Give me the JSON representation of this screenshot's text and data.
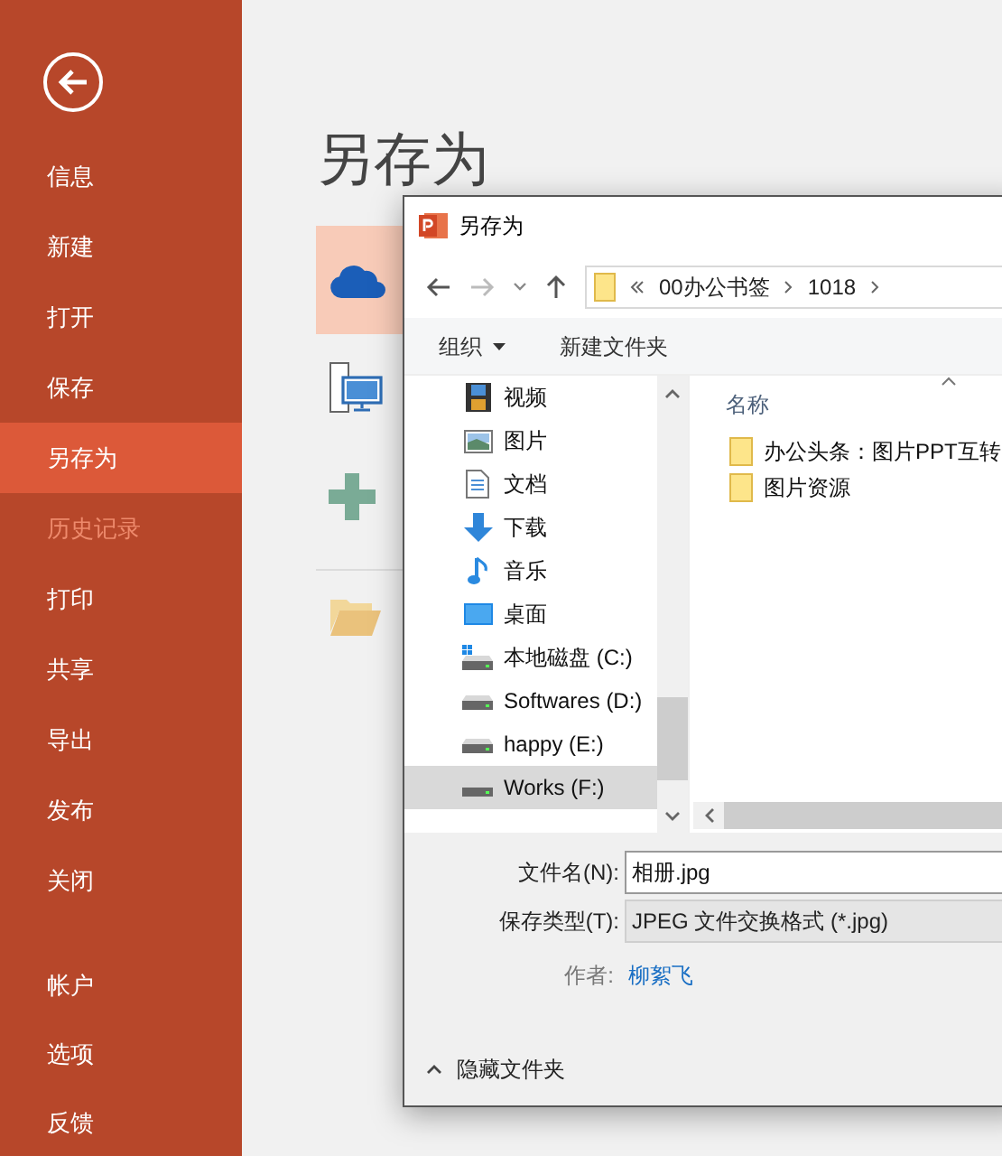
{
  "sidebar": {
    "items": [
      {
        "label": "信息",
        "selected": false,
        "disabled": false
      },
      {
        "label": "新建",
        "selected": false,
        "disabled": false
      },
      {
        "label": "打开",
        "selected": false,
        "disabled": false
      },
      {
        "label": "保存",
        "selected": false,
        "disabled": false
      },
      {
        "label": "另存为",
        "selected": true,
        "disabled": false
      },
      {
        "label": "历史记录",
        "selected": false,
        "disabled": true
      },
      {
        "label": "打印",
        "selected": false,
        "disabled": false
      },
      {
        "label": "共享",
        "selected": false,
        "disabled": false
      },
      {
        "label": "导出",
        "selected": false,
        "disabled": false
      },
      {
        "label": "发布",
        "selected": false,
        "disabled": false
      },
      {
        "label": "关闭",
        "selected": false,
        "disabled": false
      }
    ],
    "bottom_items": [
      {
        "label": "帐户"
      },
      {
        "label": "选项"
      },
      {
        "label": "反馈"
      }
    ]
  },
  "page_title": "另存为",
  "locations": [
    {
      "kind": "cloud",
      "selected": true
    },
    {
      "kind": "pc",
      "selected": false
    },
    {
      "kind": "add",
      "selected": false
    },
    {
      "kind": "browse",
      "selected": false
    }
  ],
  "dialog": {
    "title": "另存为",
    "breadcrumb": [
      "00办公书签",
      "1018"
    ],
    "toolbar": {
      "organize": "组织",
      "new_folder": "新建文件夹"
    },
    "tree": [
      {
        "label": "视频",
        "kind": "video",
        "selected": false
      },
      {
        "label": "图片",
        "kind": "pictures",
        "selected": false
      },
      {
        "label": "文档",
        "kind": "documents",
        "selected": false
      },
      {
        "label": "下载",
        "kind": "download",
        "selected": false
      },
      {
        "label": "音乐",
        "kind": "music",
        "selected": false
      },
      {
        "label": "桌面",
        "kind": "desktop",
        "selected": false
      },
      {
        "label": "本地磁盘 (C:)",
        "kind": "system_disk",
        "selected": false
      },
      {
        "label": "Softwares (D:)",
        "kind": "disk",
        "selected": false
      },
      {
        "label": "happy (E:)",
        "kind": "disk",
        "selected": false
      },
      {
        "label": "Works (F:)",
        "kind": "disk",
        "selected": true
      }
    ],
    "column_header": "名称",
    "files": [
      {
        "name": "办公头条：图片PPT互转"
      },
      {
        "name": "图片资源"
      }
    ],
    "file_name": {
      "label": "文件名(N):",
      "value": "相册.jpg"
    },
    "file_type": {
      "label": "保存类型(T):",
      "value": "JPEG 文件交换格式 (*.jpg)"
    },
    "author": {
      "label": "作者:",
      "value": "柳絮飞"
    },
    "hide_folders": "隐藏文件夹"
  }
}
